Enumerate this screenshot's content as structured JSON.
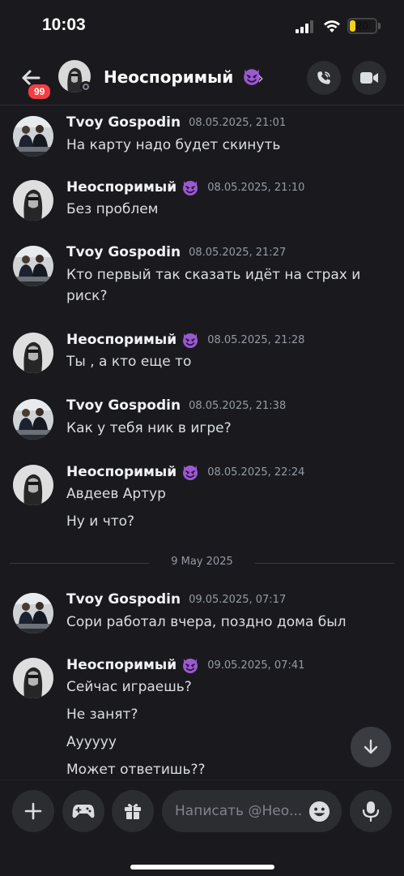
{
  "status_bar": {
    "time": "10:03",
    "battery": "20",
    "battery_level": 0.2
  },
  "header": {
    "title": "Неоспоримый",
    "unread_count": "99",
    "chevron": "›",
    "icons": [
      "back-arrow-icon",
      "phone-call-icon",
      "video-camera-icon"
    ]
  },
  "messages": [
    {
      "author": "Tvoy Gospodin",
      "timestamp": "08.05.2025, 21:01",
      "lines": [
        "На карту надо будет скинуть"
      ],
      "emoji": false
    },
    {
      "author": "Неоспоримый",
      "timestamp": "08.05.2025, 21:10",
      "lines": [
        "Без проблем"
      ],
      "emoji": true
    },
    {
      "author": "Tvoy Gospodin",
      "timestamp": "08.05.2025, 21:27",
      "lines": [
        "Кто первый так сказать идёт на страх и",
        "риск?"
      ],
      "emoji": false
    },
    {
      "author": "Неоспоримый",
      "timestamp": "08.05.2025, 21:28",
      "lines": [
        "Ты , а кто еще то"
      ],
      "emoji": true
    },
    {
      "author": "Tvoy Gospodin",
      "timestamp": "08.05.2025, 21:38",
      "lines": [
        "Как у тебя ник в игре?"
      ],
      "emoji": false
    },
    {
      "author": "Неоспоримый",
      "timestamp": "08.05.2025, 22:24",
      "lines": [
        "Авдеев Артур",
        "Ну и что?"
      ],
      "emoji": true
    },
    {
      "author": "Tvoy Gospodin",
      "timestamp": "09.05.2025, 07:17",
      "lines": [
        "Сори работал вчера, поздно дома был"
      ],
      "emoji": false
    },
    {
      "author": "Неоспоримый",
      "timestamp": "09.05.2025, 07:41",
      "lines": [
        "Сейчас играешь?",
        "Не занят?",
        "Аууууу",
        "Может ответишь??"
      ],
      "emoji": true
    }
  ],
  "date_divider": "9 May 2025",
  "composer": {
    "placeholder": "Написать @Нео...",
    "icons": [
      "plus-icon",
      "gamepad-icon",
      "gift-icon",
      "emoji-icon",
      "microphone-icon"
    ]
  },
  "colors": {
    "background": "#1a1a1e",
    "badge": "#f23f43",
    "emoji_purple": "#9b59d0",
    "battery": "#f2d21a"
  }
}
